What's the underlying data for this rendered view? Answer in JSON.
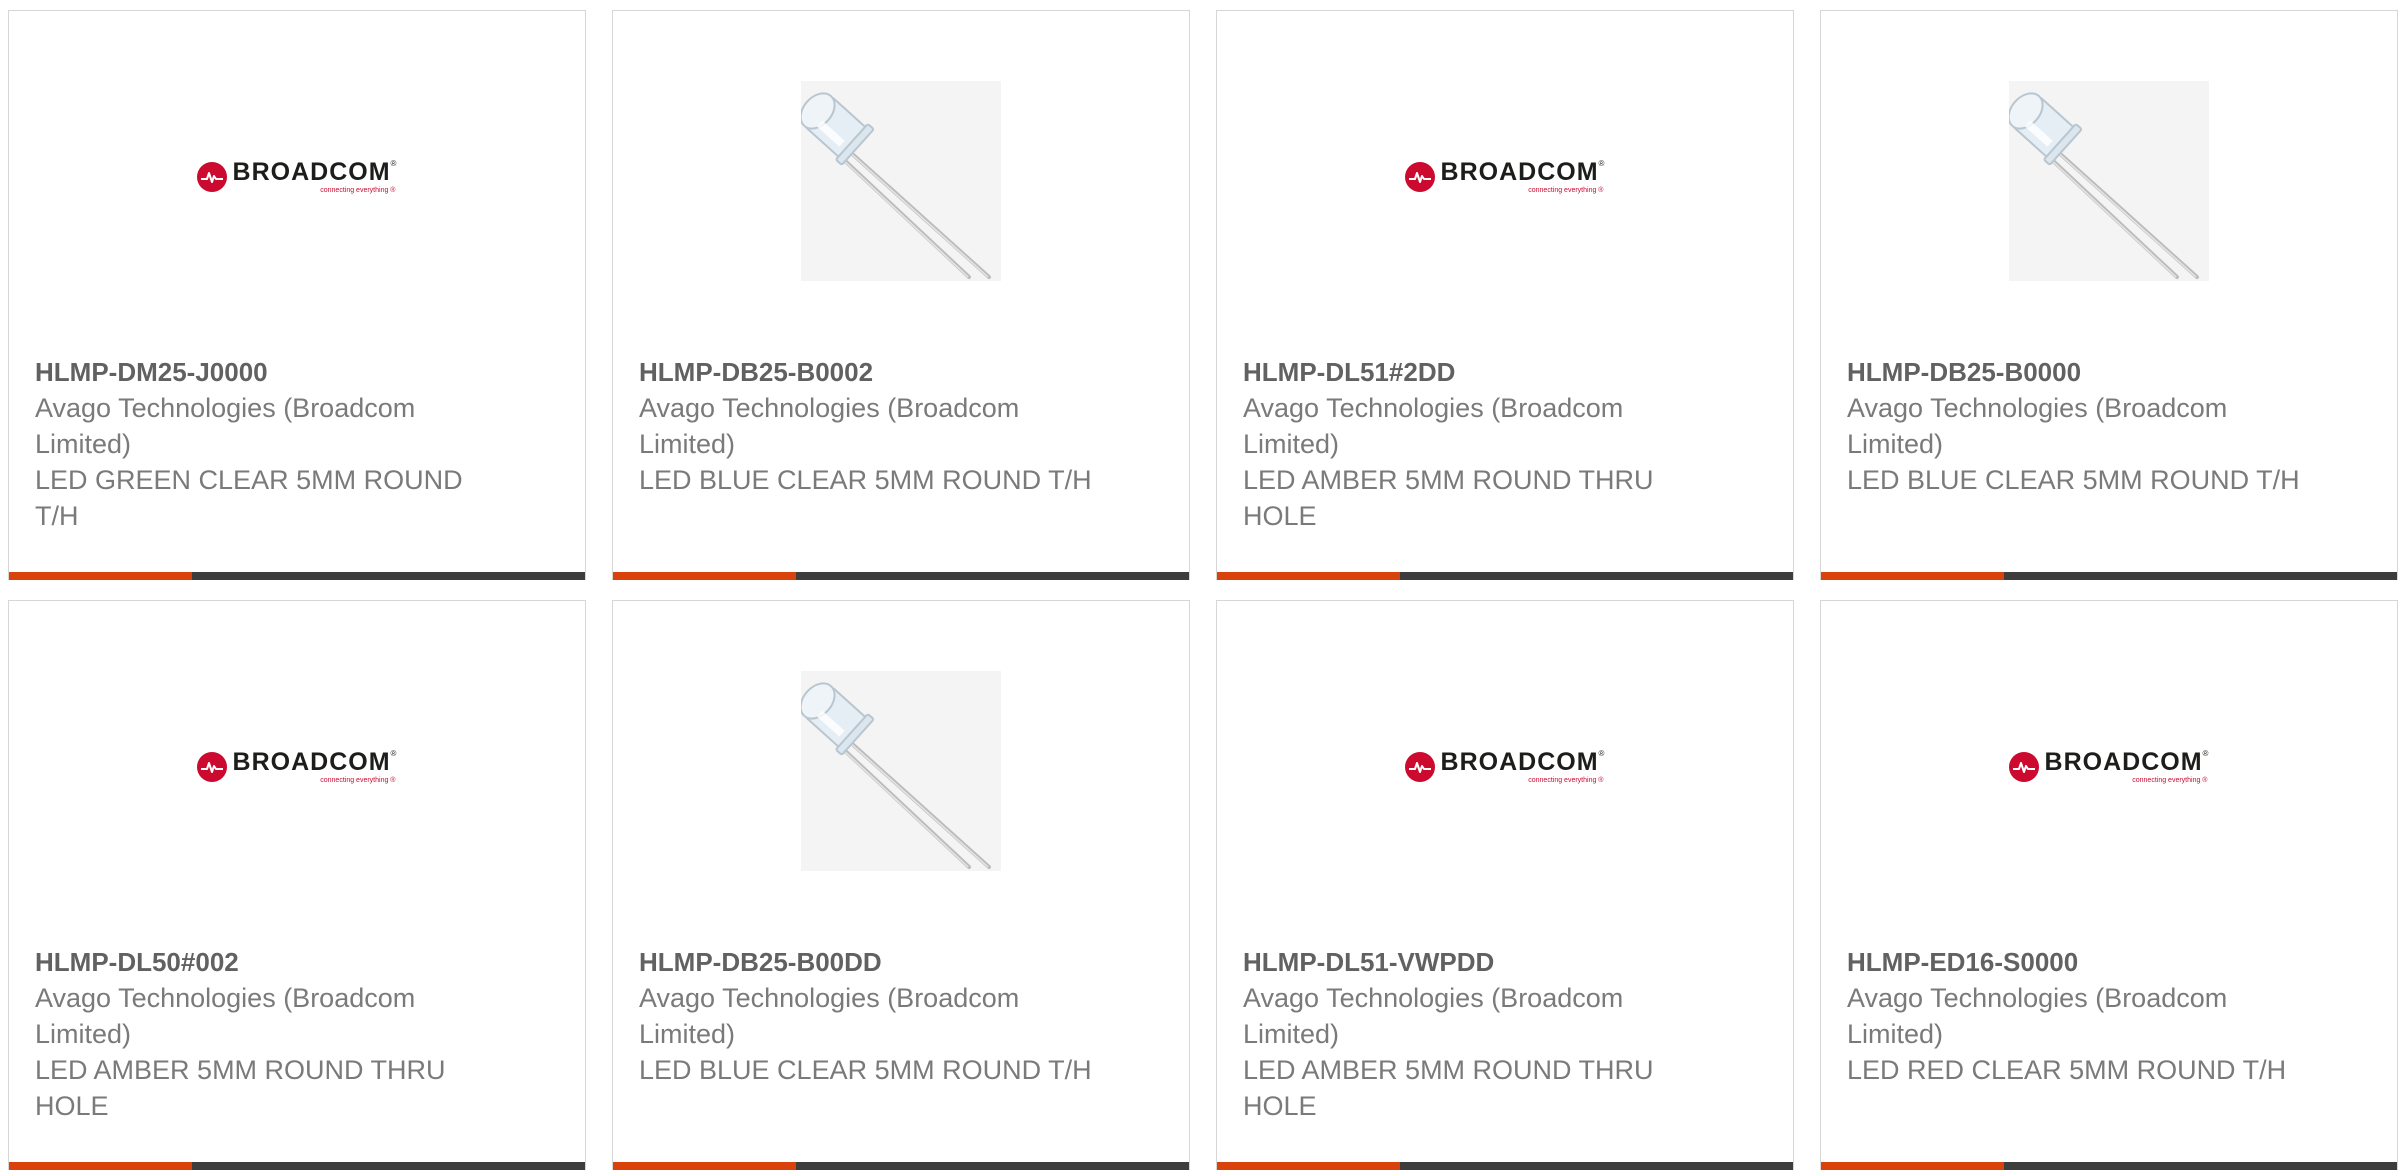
{
  "colors": {
    "accent": "#d9420b",
    "bar": "#3d3d3d",
    "brand_red": "#cc092f"
  },
  "brand_logo": {
    "word": "BROADCOM",
    "mark": "®",
    "tagline": "connecting everything ®"
  },
  "products": [
    {
      "part": "HLMP-DM25-J0000",
      "manufacturer": "Avago Technologies (Broadcom Limited)",
      "description": "LED GREEN CLEAR 5MM ROUND T/H",
      "image": "broadcom-logo"
    },
    {
      "part": "HLMP-DB25-B0002",
      "manufacturer": "Avago Technologies (Broadcom Limited)",
      "description": "LED BLUE CLEAR 5MM ROUND T/H",
      "image": "led-photo"
    },
    {
      "part": "HLMP-DL51#2DD",
      "manufacturer": "Avago Technologies (Broadcom Limited)",
      "description": "LED AMBER 5MM ROUND THRU HOLE",
      "image": "broadcom-logo"
    },
    {
      "part": "HLMP-DB25-B0000",
      "manufacturer": "Avago Technologies (Broadcom Limited)",
      "description": "LED BLUE CLEAR 5MM ROUND T/H",
      "image": "led-photo"
    },
    {
      "part": "HLMP-DL50#002",
      "manufacturer": "Avago Technologies (Broadcom Limited)",
      "description": "LED AMBER 5MM ROUND THRU HOLE",
      "image": "broadcom-logo"
    },
    {
      "part": "HLMP-DB25-B00DD",
      "manufacturer": "Avago Technologies (Broadcom Limited)",
      "description": "LED BLUE CLEAR 5MM ROUND T/H",
      "image": "led-photo"
    },
    {
      "part": "HLMP-DL51-VWPDD",
      "manufacturer": "Avago Technologies (Broadcom Limited)",
      "description": "LED AMBER 5MM ROUND THRU HOLE",
      "image": "broadcom-logo"
    },
    {
      "part": "HLMP-ED16-S0000",
      "manufacturer": "Avago Technologies (Broadcom Limited)",
      "description": "LED RED CLEAR 5MM ROUND T/H",
      "image": "broadcom-logo"
    }
  ]
}
